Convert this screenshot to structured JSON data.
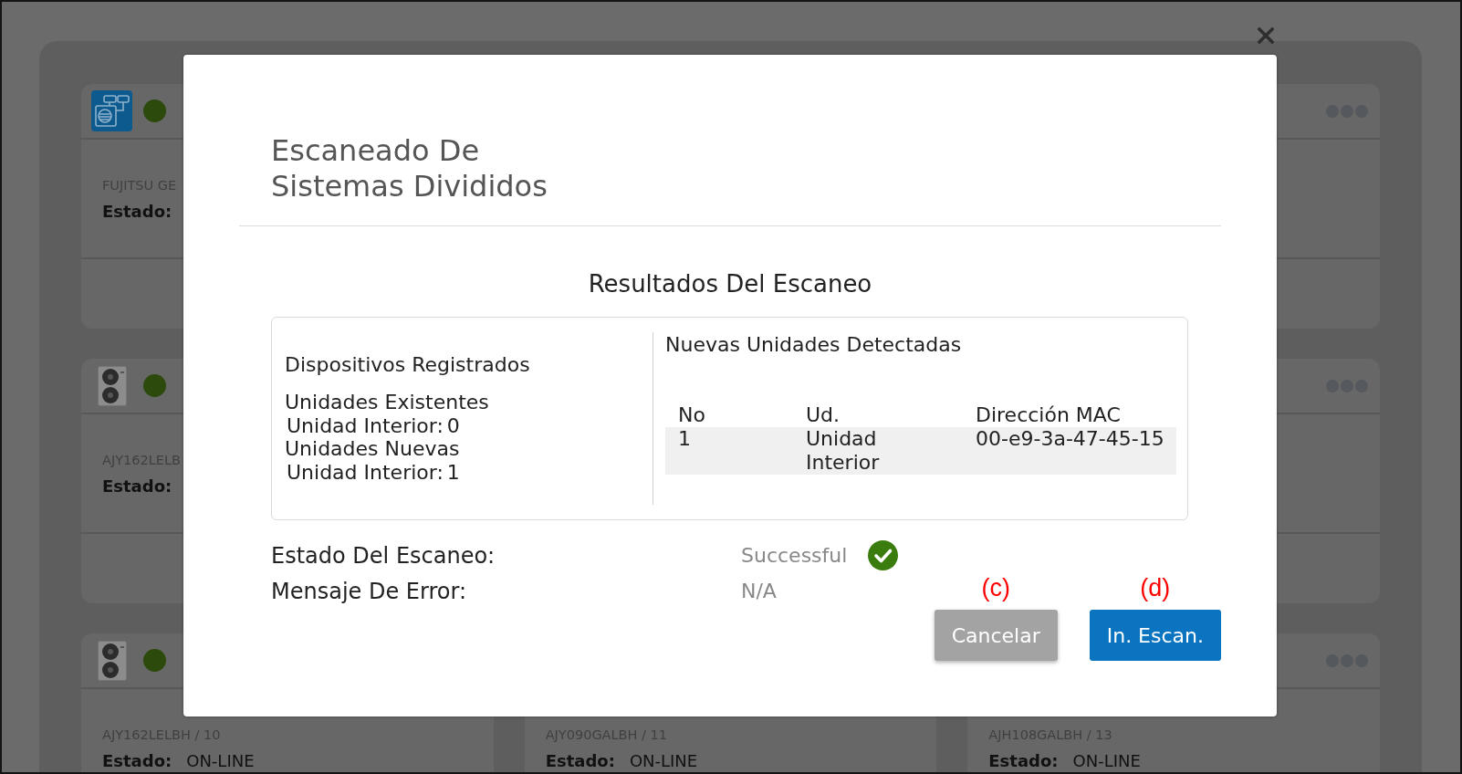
{
  "background": {
    "card_columns": [
      [
        {
          "icon": {
            "kind": "split"
          },
          "status_dot": {
            "color": "#2c4a0b"
          },
          "model": "FUJITSU GE",
          "estado": {
            "label": "Estado:"
          }
        },
        {
          "icon": {
            "kind": "outdoor"
          },
          "status_dot": {
            "color": "#2c4a0b"
          },
          "model": "AJY162LELB",
          "estado": {
            "label": "Estado:"
          }
        },
        {
          "icon": {
            "kind": "outdoor"
          },
          "status_dot": {
            "color": "#2c4a0b"
          },
          "model": "AJY162LELBH / 10",
          "estado": {
            "label": "Estado:",
            "value": "ON-LINE"
          }
        }
      ],
      [
        {
          "model": "AJY090GALBH / 11",
          "estado": {
            "label": "Estado:",
            "value": "ON-LINE"
          }
        }
      ],
      [
        {
          "menu": true
        },
        {
          "menu": true
        },
        {
          "menu": true,
          "model": "AJH108GALBH / 13",
          "estado": {
            "label": "Estado:",
            "value": "ON-LINE"
          }
        }
      ]
    ]
  },
  "dialog": {
    "title": "Escaneado De\nSistemas Divididos",
    "results": {
      "heading": "Resultados Del Escaneo",
      "registered": {
        "heading": "Dispositivos Registrados",
        "groups": [
          {
            "label": "Unidades Existentes",
            "items": [
              {
                "label": "Unidad Interior:",
                "value": "0"
              }
            ]
          },
          {
            "label": "Unidades Nuevas",
            "items": [
              {
                "label": "Unidad Interior:",
                "value": "1"
              }
            ]
          }
        ]
      },
      "detected": {
        "heading": "Nuevas Unidades Detectadas",
        "columns": [
          "No",
          "Ud.",
          "Dirección MAC"
        ],
        "rows": [
          [
            "1",
            "Unidad Interior",
            "00-e9-3a-47-45-15"
          ]
        ]
      }
    },
    "status": [
      {
        "kind": "result",
        "label": "Estado Del Escaneo:",
        "value": "Successful"
      },
      {
        "kind": "message",
        "label": "Mensaje De Error:",
        "value": "N/A"
      }
    ],
    "buttons": [
      {
        "label": "Cancelar",
        "kind": "secondary",
        "annotation": "(c)"
      },
      {
        "label": "In. Escan.",
        "kind": "primary",
        "annotation": "(d)"
      }
    ]
  }
}
